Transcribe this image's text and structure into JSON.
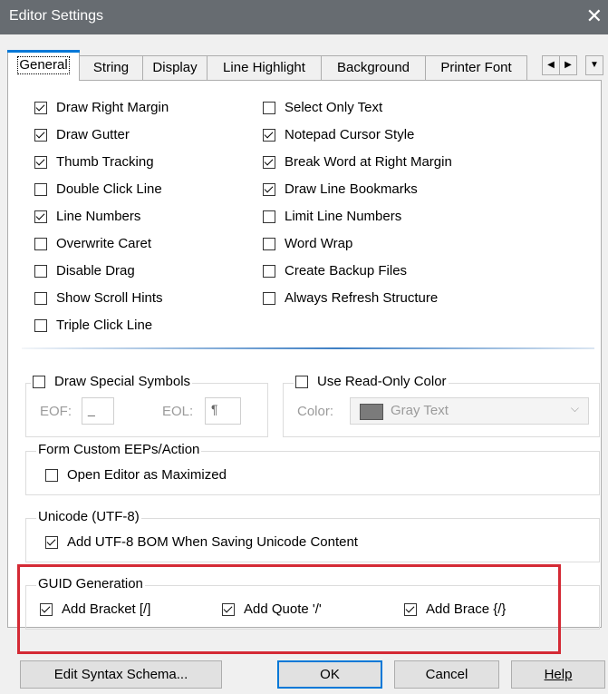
{
  "window": {
    "title": "Editor Settings",
    "close_glyph": "✕"
  },
  "tabs": [
    {
      "label": "General"
    },
    {
      "label": "String"
    },
    {
      "label": "Display"
    },
    {
      "label": "Line Highlight"
    },
    {
      "label": "Background"
    },
    {
      "label": "Printer Font"
    }
  ],
  "tab_scroll": {
    "left": "◀",
    "right": "▶",
    "menu": "▼"
  },
  "general": {
    "left": [
      {
        "label": "Draw Right Margin",
        "checked": true
      },
      {
        "label": "Draw Gutter",
        "checked": true
      },
      {
        "label": "Thumb  Tracking",
        "checked": true
      },
      {
        "label": "Double Click Line",
        "checked": false
      },
      {
        "label": "Line Numbers",
        "checked": true
      },
      {
        "label": "Overwrite Caret",
        "checked": false
      },
      {
        "label": "Disable Drag",
        "checked": false
      },
      {
        "label": "Show Scroll Hints",
        "checked": false
      },
      {
        "label": "Triple Click Line",
        "checked": false
      }
    ],
    "right": [
      {
        "label": "Select Only Text",
        "checked": false
      },
      {
        "label": "Notepad Cursor Style",
        "checked": true
      },
      {
        "label": "Break Word at Right Margin",
        "checked": true
      },
      {
        "label": "Draw Line Bookmarks",
        "checked": true
      },
      {
        "label": "Limit Line Numbers",
        "checked": false
      },
      {
        "label": "Word Wrap",
        "checked": false
      },
      {
        "label": "Create Backup Files",
        "checked": false
      },
      {
        "label": "Always Refresh Structure",
        "checked": false
      }
    ]
  },
  "special_symbols": {
    "label": "Draw Special Symbols",
    "checked": false,
    "eof_label": "EOF:",
    "eof_value": "_",
    "eol_label": "EOL:",
    "eol_value": "¶"
  },
  "readonly_color": {
    "label": "Use Read-Only Color",
    "checked": false,
    "color_label": "Color:",
    "color_value": "Gray Text",
    "swatch": "#7b7b7b"
  },
  "form_custom": {
    "legend": "Form Custom EEPs/Action",
    "option": {
      "label": "Open Editor as Maximized",
      "checked": false
    }
  },
  "unicode": {
    "legend": "Unicode (UTF-8)",
    "option": {
      "label": "Add UTF-8 BOM When Saving Unicode Content",
      "checked": true
    }
  },
  "guid": {
    "legend": "GUID Generation",
    "options": [
      {
        "label": "Add Bracket [/]",
        "checked": true
      },
      {
        "label": "Add Quote '/'",
        "checked": true
      },
      {
        "label": "Add Brace {/}",
        "checked": true
      }
    ]
  },
  "buttons": {
    "edit_syntax": "Edit Syntax Schema...",
    "ok": "OK",
    "cancel": "Cancel",
    "help": "Help"
  },
  "colors": {
    "highlight": "#d42a35",
    "accent": "#0078d7",
    "titlebar": "#676c71"
  }
}
